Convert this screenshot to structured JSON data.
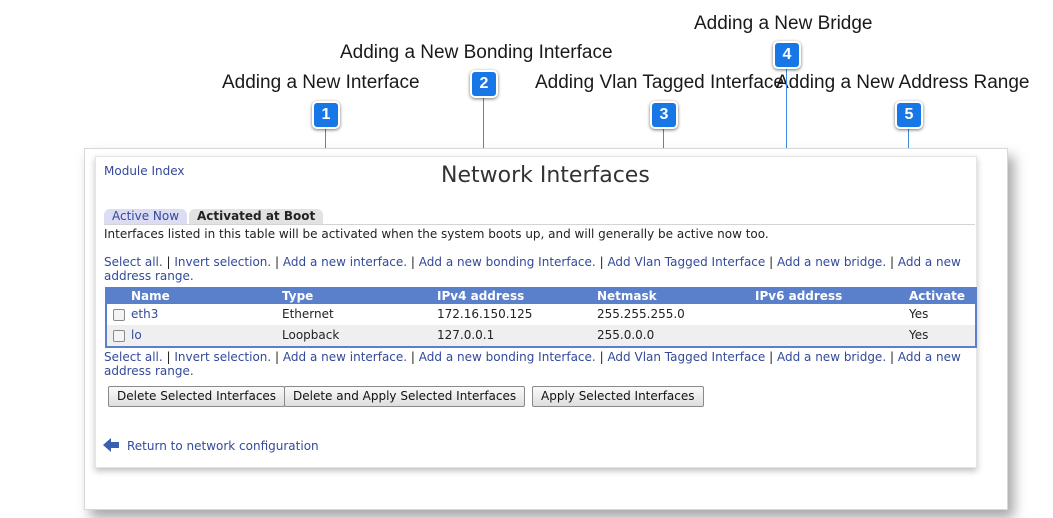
{
  "callouts": [
    {
      "num": "1",
      "label": "Adding a New Interface"
    },
    {
      "num": "2",
      "label": "Adding a New Bonding Interface"
    },
    {
      "num": "3",
      "label": "Adding Vlan Tagged Interface"
    },
    {
      "num": "4",
      "label": "Adding a New Bridge"
    },
    {
      "num": "5",
      "label": "Adding a New Address Range"
    }
  ],
  "header": {
    "module_index": "Module Index",
    "title": "Network Interfaces"
  },
  "tabs": [
    {
      "label": "Active Now"
    },
    {
      "label": "Activated at Boot"
    }
  ],
  "description": "Interfaces listed in this table will be activated when the system boots up, and will generally be active now too.",
  "links": {
    "select_all": "Select all.",
    "invert": "Invert selection.",
    "add_interface": "Add a new interface.",
    "add_bonding": "Add a new bonding Interface.",
    "add_vlan": "Add Vlan Tagged Interface",
    "add_bridge": "Add a new bridge.",
    "add_range": "Add a new address range.",
    "sep": "|"
  },
  "table": {
    "columns": [
      "Name",
      "Type",
      "IPv4 address",
      "Netmask",
      "IPv6 address",
      "Activate"
    ],
    "rows": [
      {
        "name": "eth3",
        "type": "Ethernet",
        "ipv4": "172.16.150.125",
        "netmask": "255.255.255.0",
        "ipv6": "",
        "activate": "Yes"
      },
      {
        "name": "lo",
        "type": "Loopback",
        "ipv4": "127.0.0.1",
        "netmask": "255.0.0.0",
        "ipv6": "",
        "activate": "Yes"
      }
    ]
  },
  "buttons": {
    "delete": "Delete Selected Interfaces",
    "delete_apply": "Delete and Apply Selected Interfaces",
    "apply": "Apply Selected Interfaces"
  },
  "footer": {
    "return_link": "Return to network configuration",
    "return_icon": "back-arrow-icon"
  },
  "colors": {
    "badge": "#1877e6",
    "table_header": "#5a7fcb",
    "link": "#334a9a"
  }
}
